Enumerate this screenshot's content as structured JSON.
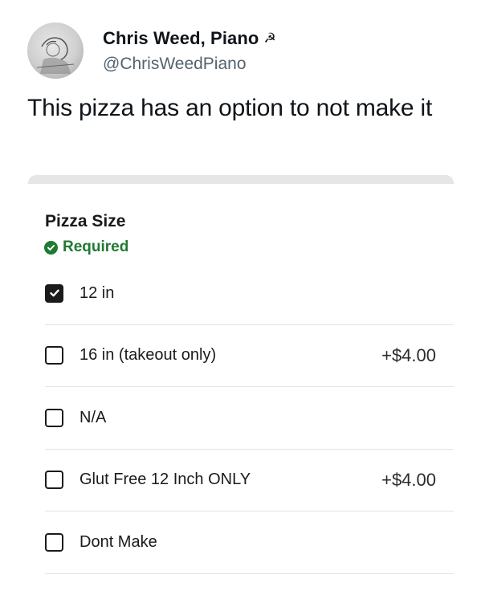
{
  "tweet": {
    "display_name": "Chris Weed, Piano",
    "name_icon": "hammer-and-sickle-icon",
    "name_icon_glyph": "☭",
    "handle": "@ChrisWeedPiano",
    "text": "This pizza has an option to not make it"
  },
  "menu_section": {
    "title": "Pizza Size",
    "required_label": "Required",
    "accent_color": "#1f7a33",
    "options": [
      {
        "label": "12 in",
        "checked": true,
        "price": ""
      },
      {
        "label": "16 in (takeout only)",
        "checked": false,
        "price": "+$4.00"
      },
      {
        "label": "N/A",
        "checked": false,
        "price": ""
      },
      {
        "label": "Glut Free 12 Inch ONLY",
        "checked": false,
        "price": "+$4.00"
      },
      {
        "label": "Dont Make",
        "checked": false,
        "price": ""
      }
    ]
  }
}
